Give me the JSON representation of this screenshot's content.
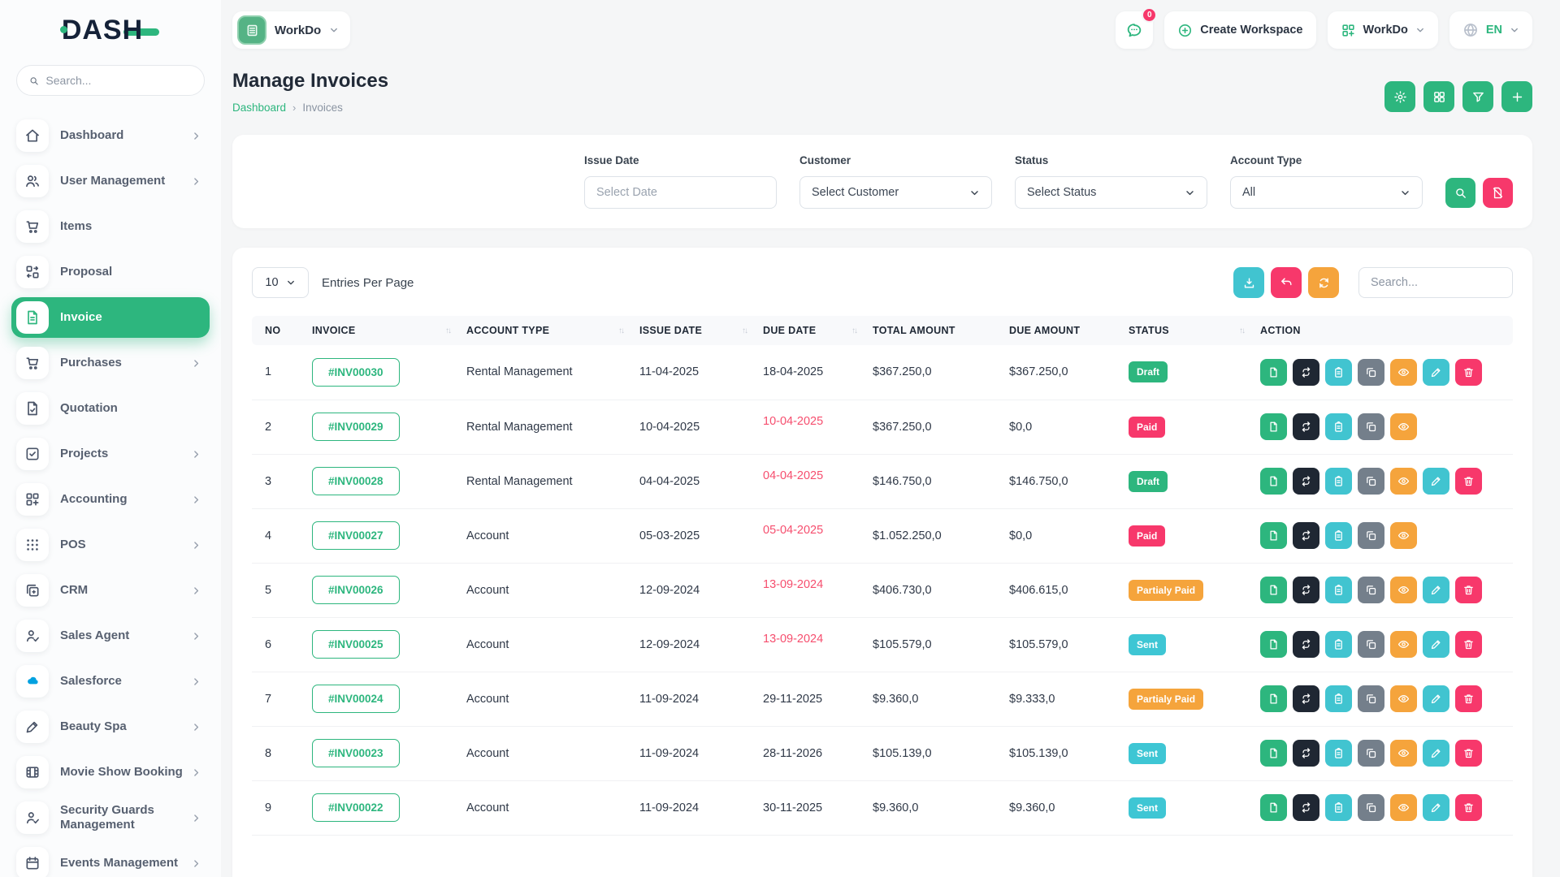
{
  "brand": {
    "logo_text": "DASH"
  },
  "sidebar": {
    "search_placeholder": "Search...",
    "items": [
      {
        "label": "Dashboard",
        "icon": "home",
        "chevron": true,
        "active": false
      },
      {
        "label": "User Management",
        "icon": "users",
        "chevron": true,
        "active": false
      },
      {
        "label": "Items",
        "icon": "cart",
        "chevron": false,
        "active": false
      },
      {
        "label": "Proposal",
        "icon": "proposal",
        "chevron": false,
        "active": false
      },
      {
        "label": "Invoice",
        "icon": "invoice",
        "chevron": false,
        "active": true
      },
      {
        "label": "Purchases",
        "icon": "cart",
        "chevron": true,
        "active": false
      },
      {
        "label": "Quotation",
        "icon": "quote",
        "chevron": false,
        "active": false
      },
      {
        "label": "Projects",
        "icon": "check-square",
        "chevron": true,
        "active": false
      },
      {
        "label": "Accounting",
        "icon": "grid-plus",
        "chevron": true,
        "active": false
      },
      {
        "label": "POS",
        "icon": "dots",
        "chevron": true,
        "active": false
      },
      {
        "label": "CRM",
        "icon": "crm",
        "chevron": true,
        "active": false
      },
      {
        "label": "Sales Agent",
        "icon": "user-check",
        "chevron": true,
        "active": false
      },
      {
        "label": "Salesforce",
        "icon": "cloud",
        "chevron": true,
        "active": false,
        "icon_color": "#00a1e0"
      },
      {
        "label": "Beauty Spa",
        "icon": "brush",
        "chevron": true,
        "active": false
      },
      {
        "label": "Movie Show Booking",
        "icon": "film",
        "chevron": true,
        "active": false
      },
      {
        "label": "Security Guards Management",
        "icon": "user-check",
        "chevron": true,
        "active": false
      },
      {
        "label": "Events Management",
        "icon": "calendar",
        "chevron": true,
        "active": false
      }
    ]
  },
  "topbar": {
    "workspace_label": "WorkDo",
    "chat_badge": "0",
    "create_workspace_label": "Create Workspace",
    "workdo_label": "WorkDo",
    "language": "EN"
  },
  "page": {
    "title": "Manage Invoices",
    "breadcrumb_home": "Dashboard",
    "breadcrumb_sep": "›",
    "breadcrumb_current": "Invoices"
  },
  "filters": {
    "issue_date_label": "Issue Date",
    "issue_date_placeholder": "Select Date",
    "customer_label": "Customer",
    "customer_value": "Select Customer",
    "status_label": "Status",
    "status_value": "Select Status",
    "account_type_label": "Account Type",
    "account_type_value": "All"
  },
  "table": {
    "entries_value": "10",
    "entries_label": "Entries Per Page",
    "search_placeholder": "Search...",
    "columns": [
      {
        "label": "NO",
        "sortable": false
      },
      {
        "label": "INVOICE",
        "sortable": true
      },
      {
        "label": "ACCOUNT TYPE",
        "sortable": true
      },
      {
        "label": "ISSUE DATE",
        "sortable": true
      },
      {
        "label": "DUE DATE",
        "sortable": true
      },
      {
        "label": "TOTAL AMOUNT",
        "sortable": false
      },
      {
        "label": "DUE AMOUNT",
        "sortable": false
      },
      {
        "label": "STATUS",
        "sortable": true
      },
      {
        "label": "ACTION",
        "sortable": false
      }
    ],
    "rows": [
      {
        "no": "1",
        "invoice": "#INV00030",
        "account_type": "Rental Management",
        "issue_date": "11-04-2025",
        "due_date": "18-04-2025",
        "due_overdue": false,
        "total_amount": "$367.250,0",
        "due_amount": "$367.250,0",
        "status": "Draft",
        "actions": [
          "file",
          "repeat",
          "clipboard",
          "copy",
          "eye",
          "edit",
          "trash"
        ]
      },
      {
        "no": "2",
        "invoice": "#INV00029",
        "account_type": "Rental Management",
        "issue_date": "10-04-2025",
        "due_date": "10-04-2025",
        "due_overdue": true,
        "total_amount": "$367.250,0",
        "due_amount": "$0,0",
        "status": "Paid",
        "actions": [
          "file",
          "repeat",
          "clipboard",
          "copy",
          "eye"
        ]
      },
      {
        "no": "3",
        "invoice": "#INV00028",
        "account_type": "Rental Management",
        "issue_date": "04-04-2025",
        "due_date": "04-04-2025",
        "due_overdue": true,
        "total_amount": "$146.750,0",
        "due_amount": "$146.750,0",
        "status": "Draft",
        "actions": [
          "file",
          "repeat",
          "clipboard",
          "copy",
          "eye",
          "edit",
          "trash"
        ]
      },
      {
        "no": "4",
        "invoice": "#INV00027",
        "account_type": "Account",
        "issue_date": "05-03-2025",
        "due_date": "05-04-2025",
        "due_overdue": true,
        "total_amount": "$1.052.250,0",
        "due_amount": "$0,0",
        "status": "Paid",
        "actions": [
          "file",
          "repeat",
          "clipboard",
          "copy",
          "eye"
        ]
      },
      {
        "no": "5",
        "invoice": "#INV00026",
        "account_type": "Account",
        "issue_date": "12-09-2024",
        "due_date": "13-09-2024",
        "due_overdue": true,
        "total_amount": "$406.730,0",
        "due_amount": "$406.615,0",
        "status": "Partialy Paid",
        "actions": [
          "file",
          "repeat",
          "clipboard",
          "copy",
          "eye",
          "edit",
          "trash"
        ]
      },
      {
        "no": "6",
        "invoice": "#INV00025",
        "account_type": "Account",
        "issue_date": "12-09-2024",
        "due_date": "13-09-2024",
        "due_overdue": true,
        "total_amount": "$105.579,0",
        "due_amount": "$105.579,0",
        "status": "Sent",
        "actions": [
          "file",
          "repeat",
          "clipboard",
          "copy",
          "eye",
          "edit",
          "trash"
        ]
      },
      {
        "no": "7",
        "invoice": "#INV00024",
        "account_type": "Account",
        "issue_date": "11-09-2024",
        "due_date": "29-11-2025",
        "due_overdue": false,
        "total_amount": "$9.360,0",
        "due_amount": "$9.333,0",
        "status": "Partialy Paid",
        "actions": [
          "file",
          "repeat",
          "clipboard",
          "copy",
          "eye",
          "edit",
          "trash"
        ]
      },
      {
        "no": "8",
        "invoice": "#INV00023",
        "account_type": "Account",
        "issue_date": "11-09-2024",
        "due_date": "28-11-2026",
        "due_overdue": false,
        "total_amount": "$105.139,0",
        "due_amount": "$105.139,0",
        "status": "Sent",
        "actions": [
          "file",
          "repeat",
          "clipboard",
          "copy",
          "eye",
          "edit",
          "trash"
        ]
      },
      {
        "no": "9",
        "invoice": "#INV00022",
        "account_type": "Account",
        "issue_date": "11-09-2024",
        "due_date": "30-11-2025",
        "due_overdue": false,
        "total_amount": "$9.360,0",
        "due_amount": "$9.360,0",
        "status": "Sent",
        "actions": [
          "file",
          "repeat",
          "clipboard",
          "copy",
          "eye",
          "edit",
          "trash"
        ]
      }
    ]
  },
  "colors": {
    "primary_green": "#2db67e",
    "pink": "#f7386b",
    "orange": "#f5a43c",
    "cyan": "#41c4d0",
    "dark": "#1f2733",
    "gray": "#747f8b",
    "overdue_red": "#f64e6e",
    "salesforce_blue": "#00a1e0",
    "status": {
      "Draft": "#2db67e",
      "Paid": "#f7386b",
      "Partialy Paid": "#f5a43c",
      "Sent": "#3ec6d4"
    },
    "action": {
      "file": "#2db67e",
      "repeat": "#1f2733",
      "clipboard": "#41c4d0",
      "copy": "#747f8b",
      "eye": "#f5a43c",
      "edit": "#41c4d0",
      "trash": "#f7386b"
    }
  }
}
